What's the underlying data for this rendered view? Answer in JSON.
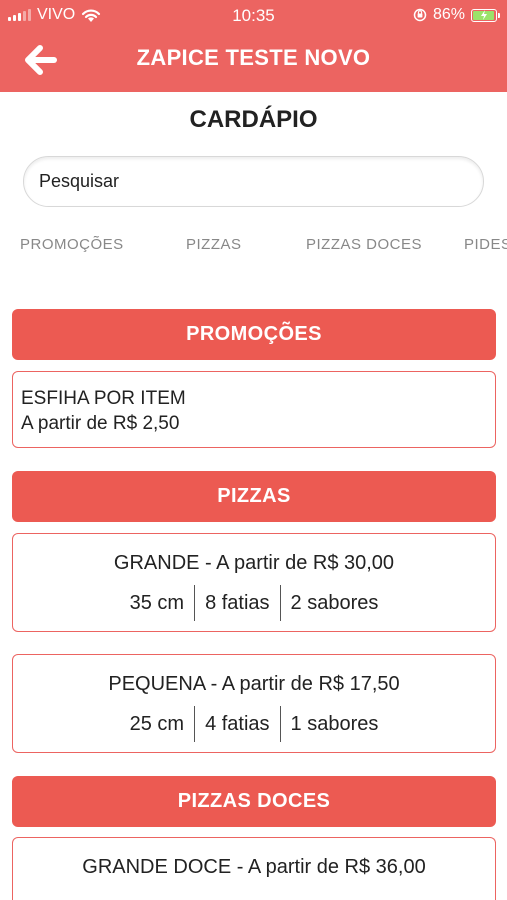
{
  "status_bar": {
    "carrier": "VIVO",
    "time": "10:35",
    "battery": "86%",
    "battery_level": 0.86
  },
  "header": {
    "title": "ZAPICE TESTE NOVO"
  },
  "page": {
    "title": "CARDÁPIO"
  },
  "search": {
    "placeholder": "Pesquisar"
  },
  "category_tabs": [
    "PROMOÇÕES",
    "PIZZAS",
    "PIZZAS DOCES",
    "PIDES"
  ],
  "sections": [
    {
      "header": "PROMOÇÕES",
      "items": [
        {
          "name": "ESFIHA POR ITEM",
          "price": "A partir de R$ 2,50"
        }
      ]
    },
    {
      "header": "PIZZAS",
      "items": [
        {
          "title": "GRANDE - A partir de R$ 30,00",
          "size": "35 cm",
          "slices": "8 fatias",
          "flavors": "2 sabores"
        },
        {
          "title": "PEQUENA - A partir de R$ 17,50",
          "size": "25 cm",
          "slices": "4 fatias",
          "flavors": "1 sabores"
        }
      ]
    },
    {
      "header": "PIZZAS DOCES",
      "items": [
        {
          "title": "GRANDE DOCE - A partir de R$ 36,00"
        }
      ]
    }
  ],
  "colors": {
    "header_bg": "#ec6461",
    "section_bg": "#ec5a52",
    "card_border": "#ec6461"
  }
}
